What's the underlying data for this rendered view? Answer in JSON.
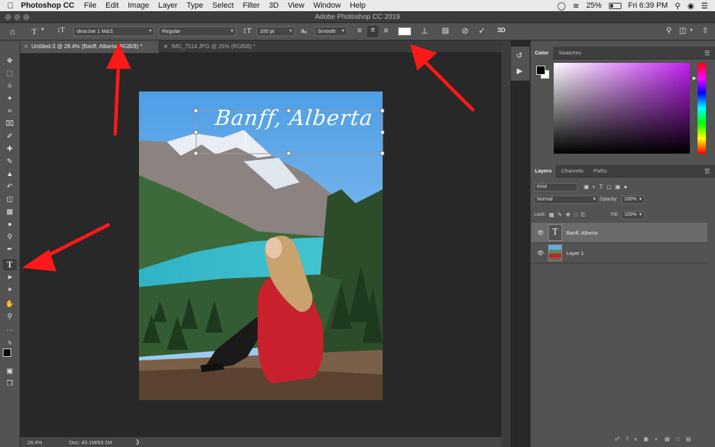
{
  "mac_menu": {
    "app_name": "Photoshop CC",
    "items": [
      "File",
      "Edit",
      "Image",
      "Layer",
      "Type",
      "Select",
      "Filter",
      "3D",
      "View",
      "Window",
      "Help"
    ],
    "battery": "25%",
    "clock": "Fri 6:39 PM"
  },
  "window": {
    "title": "Adobe Photoshop CC 2019"
  },
  "options_bar": {
    "font_family": "dearJoe 1 M&S",
    "font_style": "Regular",
    "font_size": "100 pt",
    "antialias": "Smooth",
    "aa_label": "aₐ",
    "threed_label": "3D"
  },
  "document_tabs": [
    {
      "label": "Untitled-3 @ 28.4% (Banff, Alberta, RGB/8) *",
      "active": true
    },
    {
      "label": "IMG_7514.JPG @ 25% (RGB/8) *",
      "active": false
    }
  ],
  "canvas": {
    "text_layer_text": "Banff, Alberta"
  },
  "status_bar": {
    "zoom": "28.4%",
    "doc": "Doc: 43.1M/63.1M"
  },
  "color_panel": {
    "tabs": [
      "Color",
      "Swatches"
    ]
  },
  "layers_panel": {
    "tabs": [
      "Layers",
      "Channels",
      "Paths"
    ],
    "filter_placeholder": "Kind",
    "blend_mode": "Normal",
    "opacity_label": "Opacity:",
    "opacity_value": "100%",
    "lock_label": "Lock:",
    "fill_label": "Fill:",
    "fill_value": "100%",
    "layers": [
      {
        "name": "Banff, Alberta",
        "kind": "text",
        "thumb_glyph": "T",
        "selected": true
      },
      {
        "name": "Layer 1",
        "kind": "image",
        "selected": false
      }
    ]
  },
  "colors": {
    "accent_red": "#ff1a1a",
    "panel_bg": "#535353",
    "canvas_bg": "#282828"
  }
}
